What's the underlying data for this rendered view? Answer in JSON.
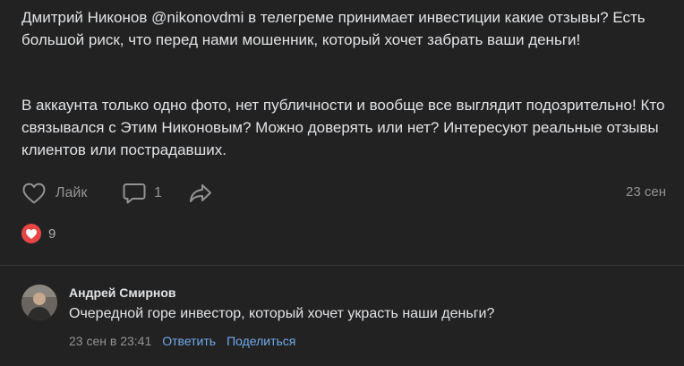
{
  "post": {
    "paragraphs": [
      "Дмитрий Никонов @nikonovdmi в телегреме принимает инвестиции какие отзывы? Есть большой риск, что перед нами мошенник, который хочет забрать ваши деньги!",
      "В аккаунта только одно фото, нет публичности и вообще все выглядит подозрительно! Кто связывался с Этим Никоновым? Можно доверять или нет? Интересуют реальные отзывы клиентов или пострадавших."
    ],
    "actions": {
      "like_label": "Лайк",
      "comment_count": "1",
      "like_icon": "heart-outline-icon",
      "comment_icon": "comment-icon",
      "share_icon": "share-arrow-icon"
    },
    "date": "23 сен",
    "reactions": {
      "icon": "heart-icon",
      "count": "9"
    }
  },
  "comment": {
    "author": "Андрей Смирнов",
    "text": "Очередной горе инвестор, который хочет украсть наши деньги?",
    "date": "23 сен в 23:41",
    "reply_label": "Ответить",
    "share_label": "Поделиться"
  },
  "colors": {
    "background": "#222222",
    "text": "#e1e3e6",
    "secondary": "#939393",
    "link": "#71aaeb",
    "heart": "#e64646",
    "divider": "#363738"
  }
}
